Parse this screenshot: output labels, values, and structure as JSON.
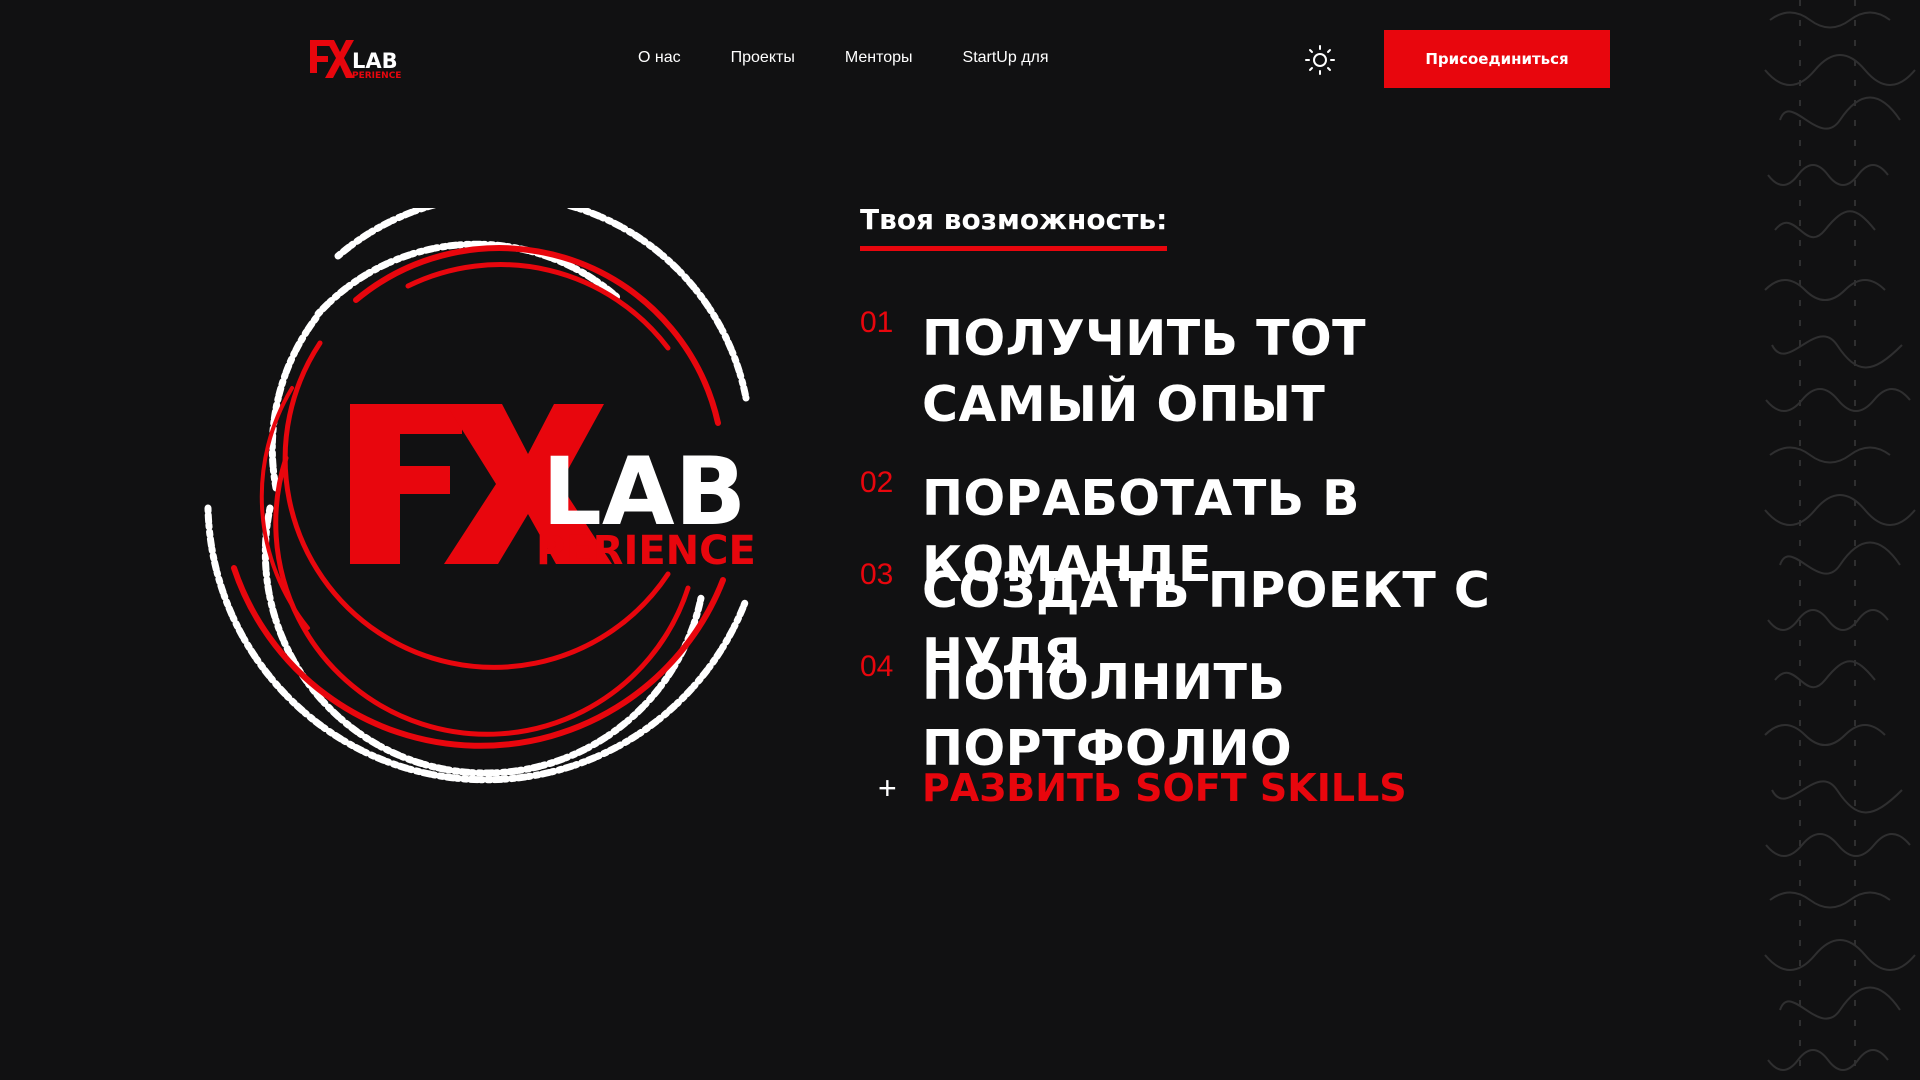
{
  "brand": {
    "logo_ex": "EX",
    "logo_lab": "LAB",
    "logo_perience": "PERIENCE",
    "red": "#e8060d",
    "background": "#111112"
  },
  "nav": {
    "items": [
      {
        "label": "О нас"
      },
      {
        "label": "Проекты"
      },
      {
        "label": "Менторы"
      },
      {
        "label": "StartUp для"
      }
    ]
  },
  "header": {
    "theme_toggle_icon": "sun-icon",
    "join_label": "Присоединиться"
  },
  "content": {
    "heading": "Твоя возможность:",
    "items": [
      {
        "num": "01",
        "text": "ПОЛУЧИТЬ ТОТ САМЫЙ ОПЫТ"
      },
      {
        "num": "02",
        "text": "ПОРАБОТАТЬ В КОМАНДЕ"
      },
      {
        "num": "03",
        "text": "СОЗДАТЬ ПРОЕКТ С НУЛЯ"
      },
      {
        "num": "04",
        "text": "ПОПОЛНИТЬ ПОРТФОЛИО"
      }
    ],
    "bonus_icon": "plus-icon",
    "bonus_symbol": "+",
    "bonus": "РАЗВИТЬ SOFT SKILLS"
  }
}
